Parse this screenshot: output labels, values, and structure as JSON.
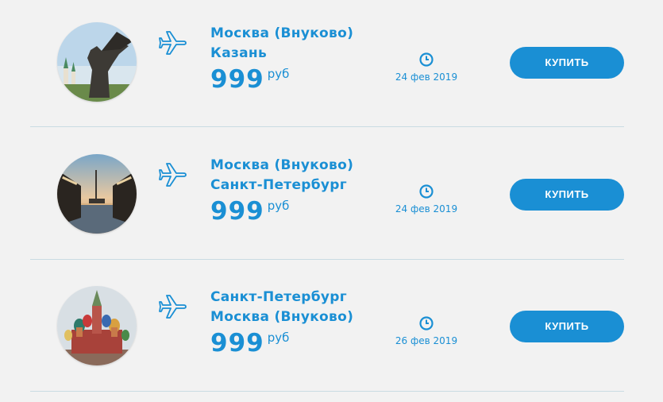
{
  "offers": [
    {
      "image": "kazan-zilant-photo",
      "from": "Москва (Внуково)",
      "to": "Казань",
      "price": "999",
      "currency": "руб",
      "date": "24 фев 2019",
      "button": "КУПИТЬ"
    },
    {
      "image": "saint-petersburg-bridge-photo",
      "from": "Москва (Внуково)",
      "to": "Санкт-Петербург",
      "price": "999",
      "currency": "руб",
      "date": "24 фев 2019",
      "button": "КУПИТЬ"
    },
    {
      "image": "moscow-st-basil-photo",
      "from": "Санкт-Петербург",
      "to": "Москва (Внуково)",
      "price": "999",
      "currency": "руб",
      "date": "26 фев 2019",
      "button": "КУПИТЬ"
    }
  ],
  "colors": {
    "accent": "#1a8fd4",
    "divider": "#c9dbe3",
    "background": "#f2f2f2"
  },
  "icons": {
    "flight": "plane-icon",
    "date": "clock-icon"
  }
}
